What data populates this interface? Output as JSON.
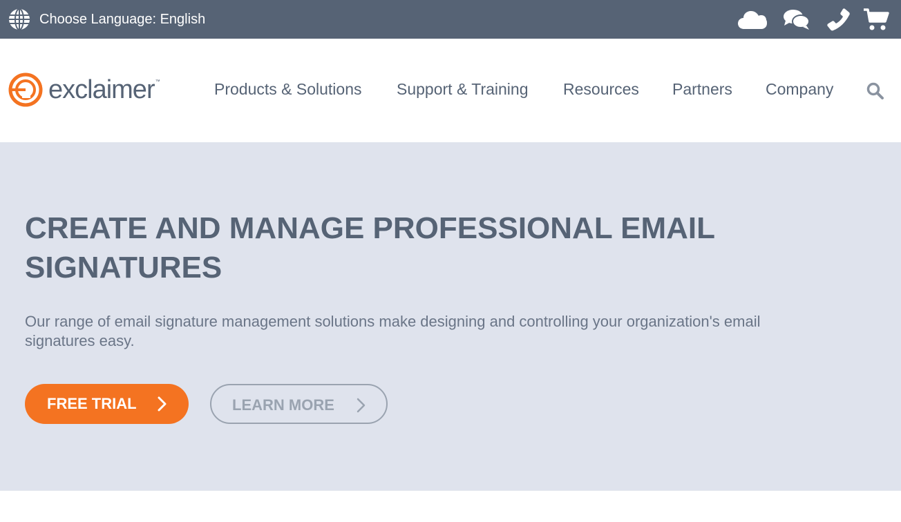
{
  "topbar": {
    "language_label": "Choose Language: English",
    "icons": [
      "globe-icon",
      "cloud-icon",
      "chat-icon",
      "phone-icon",
      "cart-icon"
    ]
  },
  "brand": {
    "name": "exclaimer",
    "trademark": "™",
    "accent_color": "#f47321",
    "primary_color": "#566375"
  },
  "nav": {
    "items": [
      {
        "label": "Products & Solutions"
      },
      {
        "label": "Support & Training"
      },
      {
        "label": "Resources"
      },
      {
        "label": "Partners"
      },
      {
        "label": "Company"
      }
    ],
    "search_icon": "search-icon"
  },
  "hero": {
    "title": "CREATE AND MANAGE PROFESSIONAL EMAIL SIGNATURES",
    "subtitle": "Our range of email signature management solutions make designing and controlling your organization's email signatures easy.",
    "primary_button": "FREE TRIAL",
    "secondary_button": "LEARN MORE",
    "background_color": "#dfe3ed"
  }
}
